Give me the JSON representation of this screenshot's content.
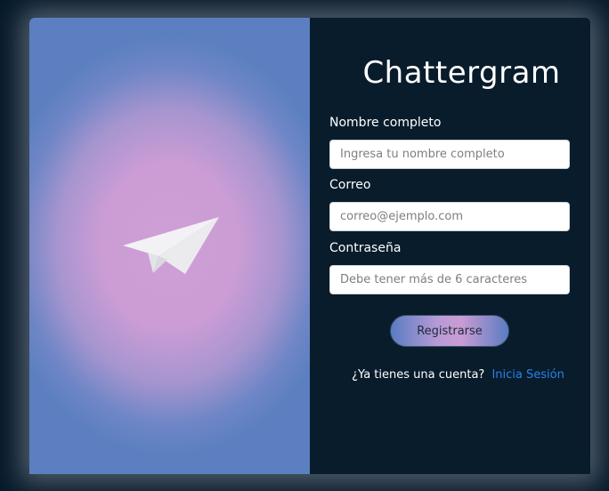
{
  "app": {
    "title": "Chattergram",
    "icon": "paper-plane-icon"
  },
  "form": {
    "name": {
      "label": "Nombre completo",
      "placeholder": "Ingresa tu nombre completo",
      "value": ""
    },
    "email": {
      "label": "Correo",
      "placeholder": "correo@ejemplo.com",
      "value": ""
    },
    "password": {
      "label": "Contraseña",
      "placeholder": "Debe tener más de 6 caracteres",
      "value": ""
    },
    "submit_label": "Registrarse"
  },
  "footer": {
    "question": "¿Ya tienes una cuenta?",
    "link_label": "Inicia Sesión"
  },
  "colors": {
    "background": "#071a2b",
    "panel": "#081c2c",
    "gradient_center": "#cf9fd6",
    "gradient_edge": "#5b7fc0",
    "link": "#2b80e8"
  }
}
